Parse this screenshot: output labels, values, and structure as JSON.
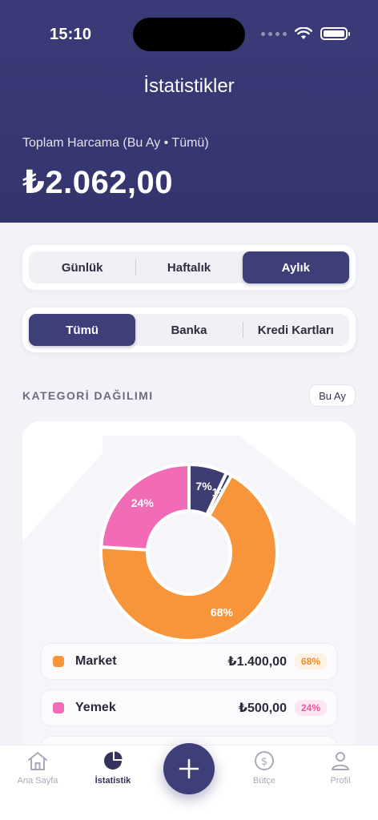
{
  "status": {
    "time": "15:10"
  },
  "header": {
    "title": "İstatistikler",
    "total_label": "Toplam Harcama (Bu Ay • Tümü)",
    "total_value": "₺2.062,00"
  },
  "period_tabs": [
    {
      "label": "Günlük",
      "active": false
    },
    {
      "label": "Haftalık",
      "active": false
    },
    {
      "label": "Aylık",
      "active": true
    }
  ],
  "account_tabs": [
    {
      "label": "Tümü",
      "active": true
    },
    {
      "label": "Banka",
      "active": false
    },
    {
      "label": "Kredi Kartları",
      "active": false
    }
  ],
  "section": {
    "title": "KATEGORİ DAĞILIMI",
    "period_badge": "Bu Ay"
  },
  "chart_data": {
    "type": "pie",
    "categories": [
      "Market",
      "Yemek",
      "",
      ""
    ],
    "values": [
      68,
      24,
      7,
      1
    ],
    "labels": [
      "68%",
      "24%",
      "7%",
      "1%"
    ],
    "colors": [
      "#f7953a",
      "#f26bb6",
      "#3d3d72",
      "#3d3d72"
    ]
  },
  "legend": [
    {
      "name": "Market",
      "amount": "₺1.400,00",
      "percent": "68%",
      "color": "#f7953a",
      "badge_bg": "#fff1e4",
      "badge_fg": "#f08a2c"
    },
    {
      "name": "Yemek",
      "amount": "₺500,00",
      "percent": "24%",
      "color": "#f26bb6",
      "badge_bg": "#fde6f2",
      "badge_fg": "#e85aa6"
    }
  ],
  "tabbar": {
    "home": "Ana Sayfa",
    "stats": "İstatistik",
    "budget": "Bütçe",
    "profile": "Profil"
  },
  "colors": {
    "primary": "#3e3e78",
    "header": "#38386f",
    "background": "#f2f2f8"
  }
}
